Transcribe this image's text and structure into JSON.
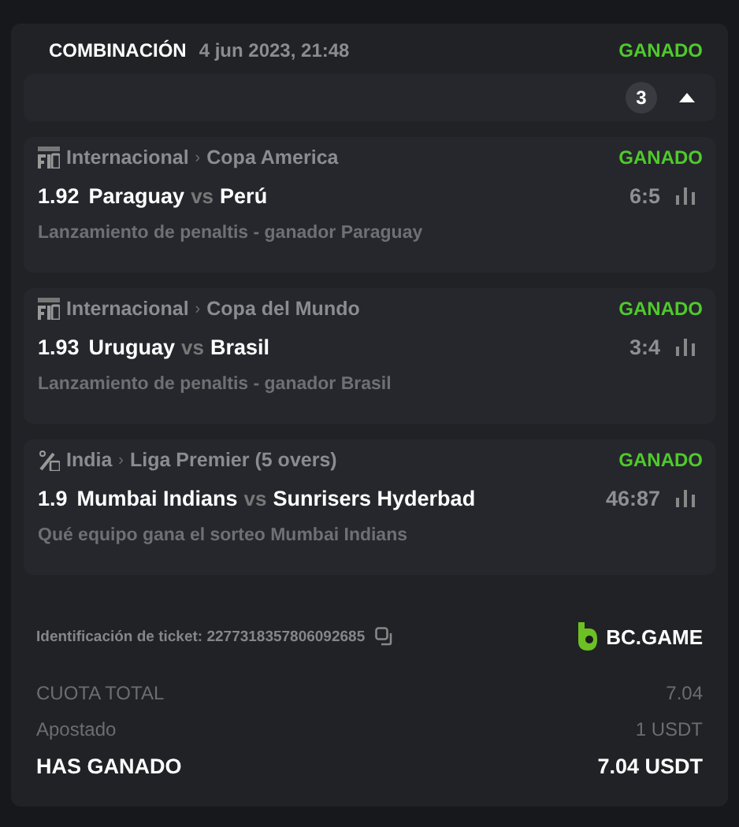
{
  "header": {
    "title": "COMBINACIÓN",
    "date": "4 jun 2023, 21:48",
    "status": "GANADO"
  },
  "legs_bar": {
    "count": "3",
    "expanded": true
  },
  "matches": [
    {
      "kind": "fifa",
      "country": "Internacional",
      "separator": "›",
      "league": "Copa America",
      "status": "GANADO",
      "odds": "1.92",
      "home": "Paraguay",
      "vs": "vs",
      "away": "Perú",
      "score": "6:5",
      "market": "Lanzamiento de penaltis - ganador Paraguay"
    },
    {
      "kind": "fifa",
      "country": "Internacional",
      "separator": "›",
      "league": "Copa del Mundo",
      "status": "GANADO",
      "odds": "1.93",
      "home": "Uruguay",
      "vs": "vs",
      "away": "Brasil",
      "score": "3:4",
      "market": "Lanzamiento de penaltis - ganador Brasil"
    },
    {
      "kind": "cricket",
      "country": "India",
      "separator": "›",
      "league": "Liga Premier (5 overs)",
      "status": "GANADO",
      "odds": "1.9",
      "home": "Mumbai Indians",
      "vs": "vs",
      "away": "Sunrisers Hyderbad",
      "score": "46:87",
      "market": "Qué equipo gana el sorteo Mumbai Indians"
    }
  ],
  "ticket": {
    "label": "Identificación de ticket: 2277318357806092685",
    "brand": "BC.GAME"
  },
  "summary": [
    {
      "kind": "plain",
      "label": "CUOTA TOTAL",
      "value": "7.04"
    },
    {
      "kind": "plain",
      "label": "Apostado",
      "value": "1 USDT"
    },
    {
      "kind": "total",
      "label": "HAS GANADO",
      "value": "7.04 USDT"
    }
  ]
}
